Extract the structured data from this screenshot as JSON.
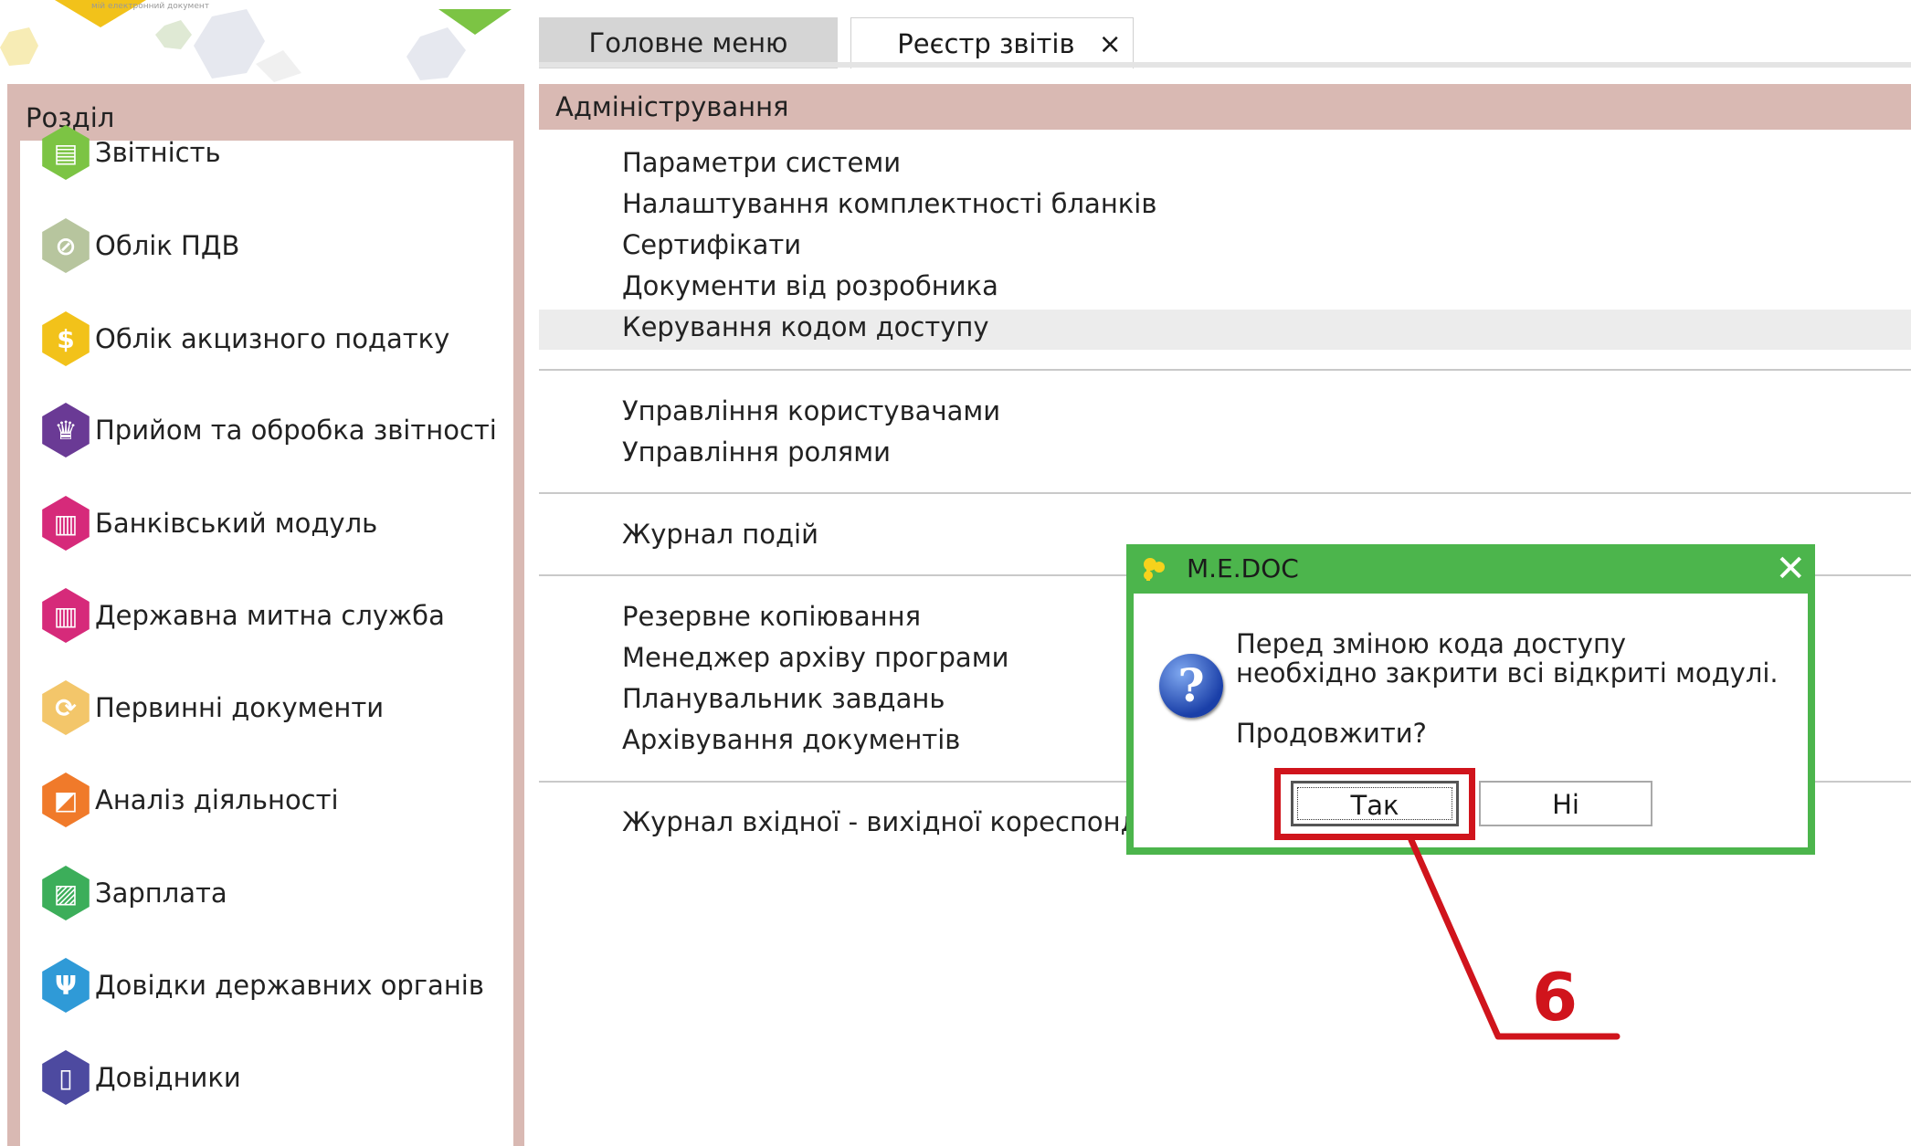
{
  "tabs": [
    {
      "label": "Головне меню"
    },
    {
      "label": "Реєстр звітів",
      "close_icon": "×"
    }
  ],
  "sidebar": {
    "title": "Розділ",
    "items": [
      {
        "label": "Звітність",
        "icon": "report-icon",
        "color": "#7cc444",
        "glyph": "▤"
      },
      {
        "label": "Облік ПДВ",
        "icon": "vat-icon",
        "color": "#b7c59e",
        "glyph": "⊘"
      },
      {
        "label": "Облік акцизного податку",
        "icon": "money-bag-icon",
        "color": "#f2c21a",
        "glyph": "$"
      },
      {
        "label": "Прийом та обробка звітності",
        "icon": "crown-icon",
        "color": "#6a3a95",
        "glyph": "♛"
      },
      {
        "label": "Банківський модуль",
        "icon": "bank-icon",
        "color": "#d62a7a",
        "glyph": "▥"
      },
      {
        "label": "Державна митна служба",
        "icon": "customs-icon",
        "color": "#d62a7a",
        "glyph": "▥"
      },
      {
        "label": "Первинні документи",
        "icon": "documents-icon",
        "color": "#f3c66a",
        "glyph": "⟳"
      },
      {
        "label": "Аналіз діяльності",
        "icon": "analysis-icon",
        "color": "#f07a2a",
        "glyph": "◩"
      },
      {
        "label": "Зарплата",
        "icon": "salary-icon",
        "color": "#3cae5a",
        "glyph": "▨"
      },
      {
        "label": "Довідки державних органів",
        "icon": "trident-icon",
        "color": "#2f9ad7",
        "glyph": "Ψ"
      },
      {
        "label": "Довідники",
        "icon": "book-icon",
        "color": "#4d4aa0",
        "glyph": "▯"
      }
    ]
  },
  "main": {
    "section_title": "Адміністрування",
    "groups": [
      [
        "Параметри системи",
        "Налаштування комплектності бланків",
        "Сертифікати",
        "Документи від розробника",
        "Керування кодом доступу"
      ],
      [
        "Управління користувачами",
        "Управління ролями"
      ],
      [
        "Журнал подій"
      ],
      [
        "Резервне копіювання",
        "Менеджер архіву програми",
        "Планувальник завдань",
        "Архівування документів"
      ],
      [
        "Журнал вхідної - вихідної кореспонде"
      ]
    ]
  },
  "dialog": {
    "title": "M.E.DOC",
    "close_icon": "✕",
    "question_glyph": "?",
    "message_line1": "Перед зміною кода доступу",
    "message_line2": "необхідно закрити всі відкриті модулі.",
    "message_line3": "Продовжити?",
    "yes_label": "Так",
    "no_label": "Ні",
    "accent_color": "#4cb54c"
  },
  "annotation": {
    "number": "6",
    "color": "#d0141c"
  }
}
